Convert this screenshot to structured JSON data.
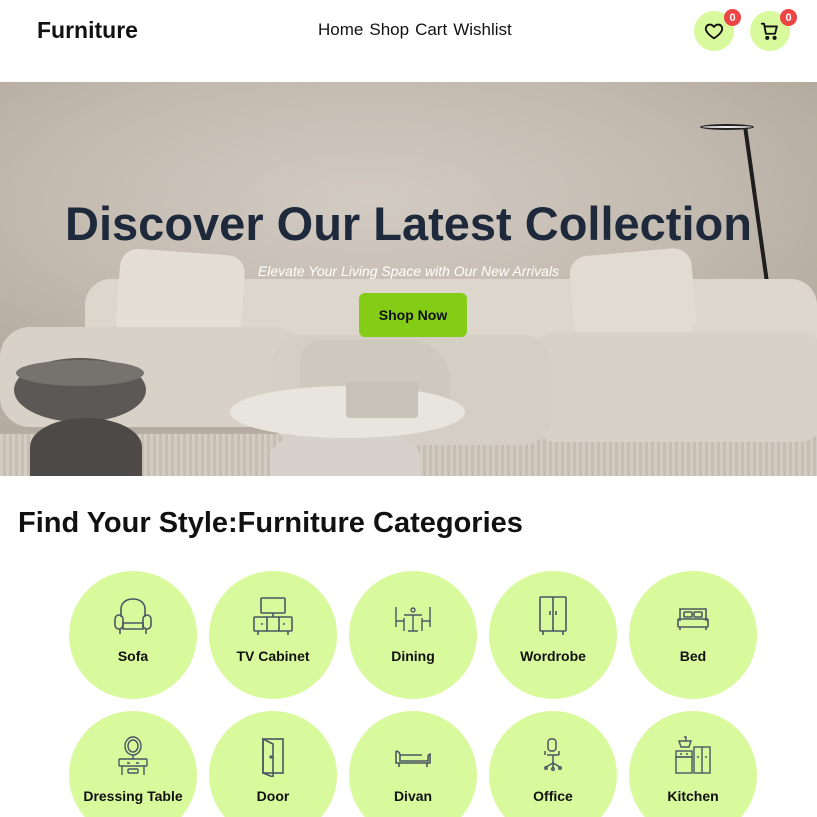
{
  "header": {
    "brand": "Furniture",
    "nav": [
      {
        "label": "Home"
      },
      {
        "label": "Shop"
      },
      {
        "label": "Cart"
      },
      {
        "label": "Wishlist"
      }
    ],
    "wishlist_count": "0",
    "cart_count": "0",
    "wishlist_icon": "heart-icon",
    "cart_icon": "shopping-cart-icon"
  },
  "hero": {
    "title": "Discover Our Latest Collection",
    "subtitle": "Elevate Your Living Space with Our New Arrivals",
    "cta_label": "Shop Now"
  },
  "categories": {
    "title": "Find Your Style:Furniture Categories",
    "items": [
      {
        "label": "Sofa",
        "icon": "armchair-icon"
      },
      {
        "label": "TV Cabinet",
        "icon": "tv-cabinet-icon"
      },
      {
        "label": "Dining",
        "icon": "dining-set-icon"
      },
      {
        "label": "Wordrobe",
        "icon": "wardrobe-icon"
      },
      {
        "label": "Bed",
        "icon": "bed-icon"
      },
      {
        "label": "Dressing Table",
        "icon": "dressing-table-icon"
      },
      {
        "label": "Door",
        "icon": "door-icon"
      },
      {
        "label": "Divan",
        "icon": "divan-icon"
      },
      {
        "label": "Office",
        "icon": "office-chair-icon"
      },
      {
        "label": "Kitchen",
        "icon": "kitchen-icon"
      }
    ]
  },
  "colors": {
    "accent": "#d9f99d",
    "cta": "#84cc16",
    "badge": "#ef4444",
    "hero_title": "#1e293b"
  }
}
